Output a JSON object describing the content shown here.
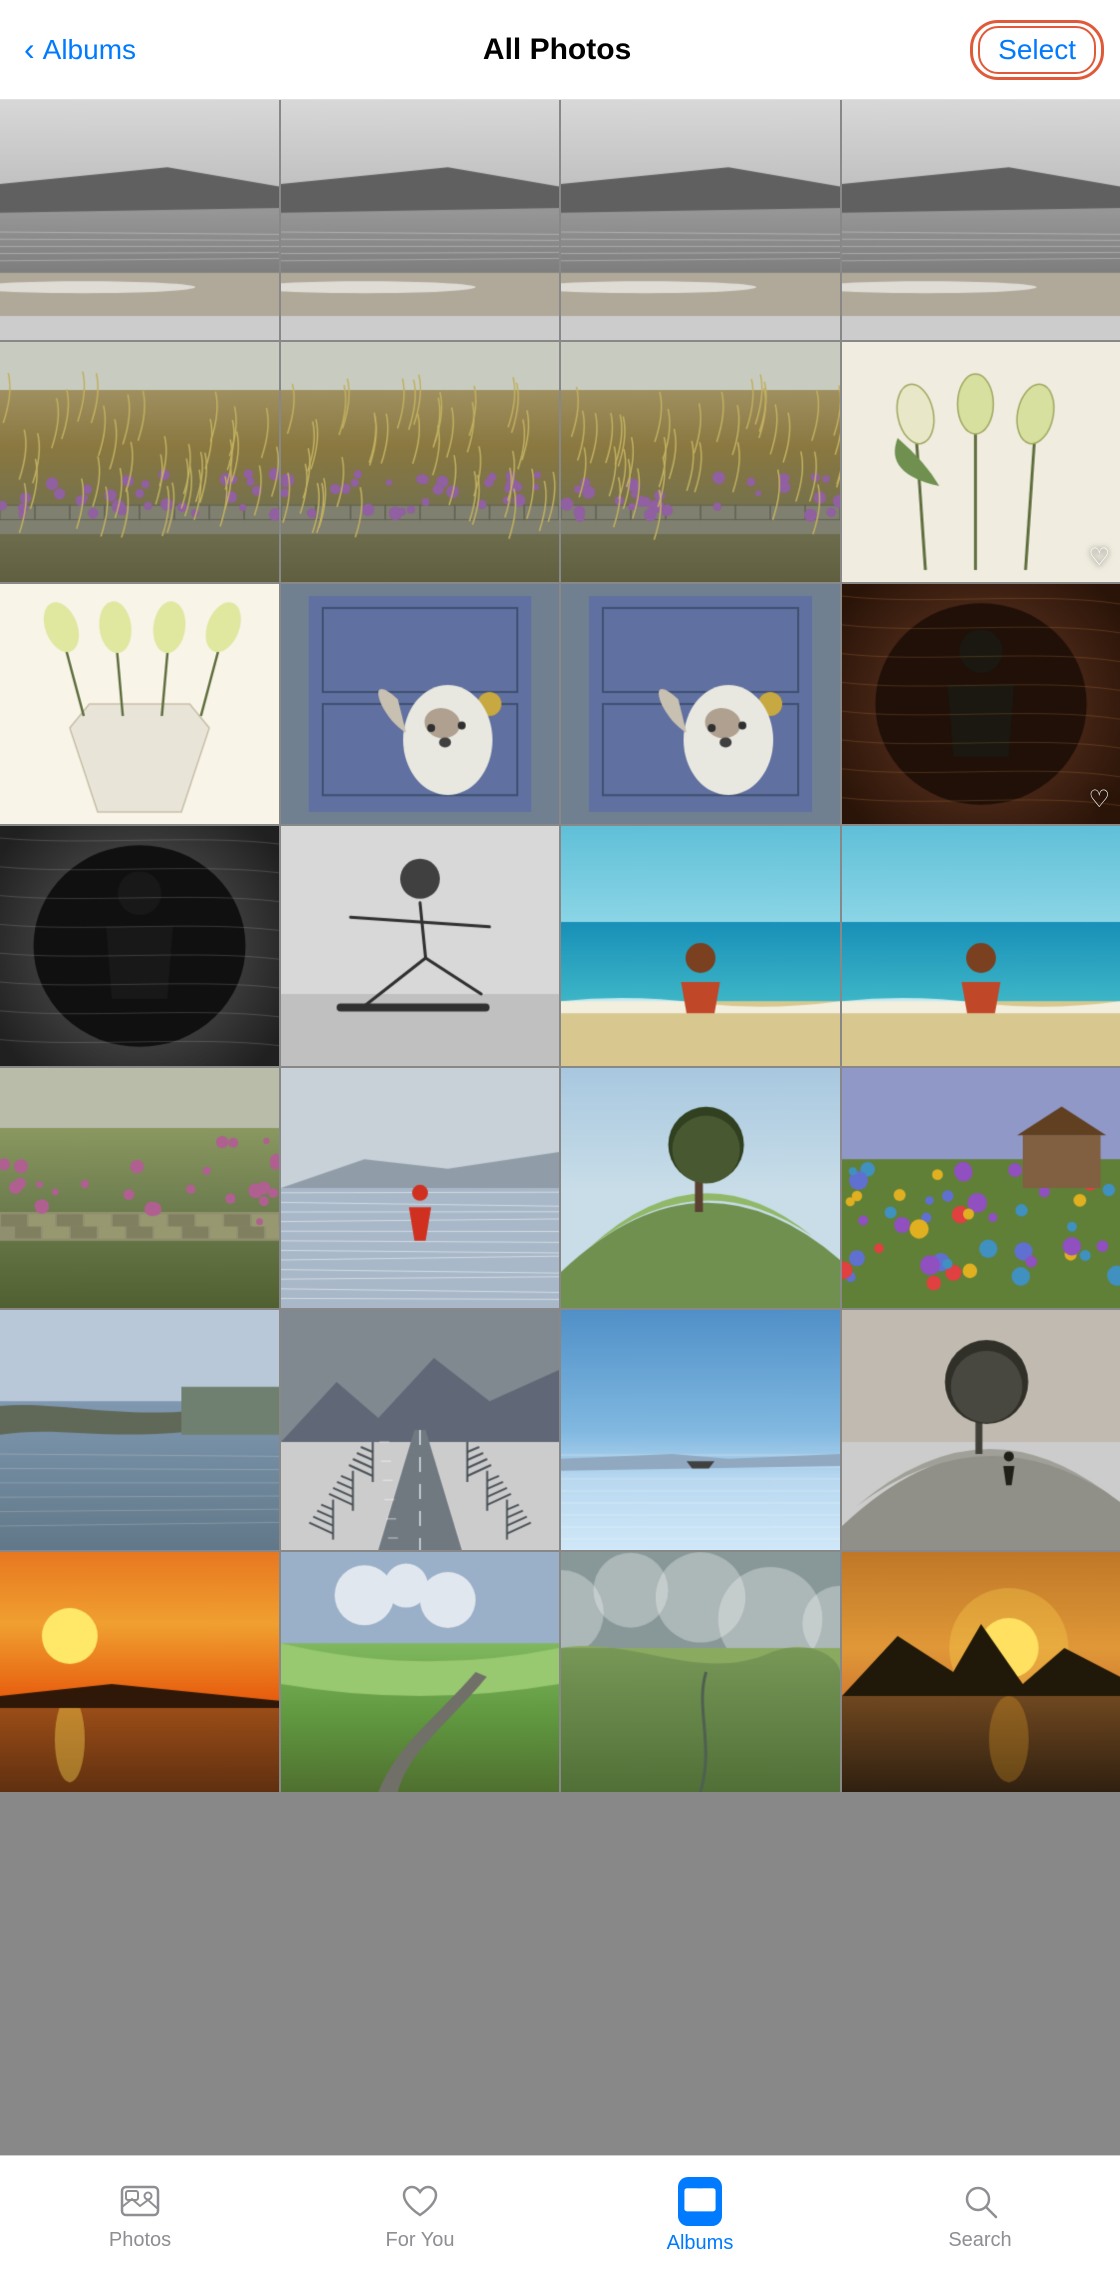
{
  "nav": {
    "back_label": "Albums",
    "title": "All Photos",
    "select_label": "Select"
  },
  "tabs": [
    {
      "id": "photos",
      "label": "Photos",
      "active": false
    },
    {
      "id": "for-you",
      "label": "For You",
      "active": false
    },
    {
      "id": "albums",
      "label": "Albums",
      "active": true
    },
    {
      "id": "search",
      "label": "Search",
      "active": false
    }
  ],
  "photos": [
    {
      "id": 1,
      "desc": "coastal landscape bw",
      "row": 0,
      "col": 0,
      "colors": [
        "#a0a0a0",
        "#888",
        "#606060",
        "#d0d0d0"
      ],
      "heart": false
    },
    {
      "id": 2,
      "desc": "coastal landscape bw 2",
      "row": 0,
      "col": 1,
      "colors": [
        "#a0a0a0",
        "#888",
        "#606060",
        "#d0d0d0"
      ],
      "heart": false
    },
    {
      "id": 3,
      "desc": "coastal landscape bw 3",
      "row": 0,
      "col": 2,
      "colors": [
        "#a0a0a0",
        "#888",
        "#606060",
        "#d0d0d0"
      ],
      "heart": false
    },
    {
      "id": 4,
      "desc": "coastal landscape bw 4",
      "row": 0,
      "col": 3,
      "colors": [
        "#a0a0a0",
        "#888",
        "#606060",
        "#d0d0d0"
      ],
      "heart": false
    },
    {
      "id": 5,
      "desc": "grass fields purple flowers",
      "row": 1,
      "col": 0,
      "colors": [
        "#7a8a60",
        "#5d6b45",
        "#c8b060",
        "#9a7a50"
      ],
      "heart": false
    },
    {
      "id": 6,
      "desc": "grass fields purple flowers 2",
      "row": 1,
      "col": 1,
      "colors": [
        "#7a8a60",
        "#5d6b45",
        "#c8b060",
        "#9a7a50"
      ],
      "heart": false
    },
    {
      "id": 7,
      "desc": "grass fields purple flowers 3",
      "row": 1,
      "col": 2,
      "colors": [
        "#7a8a60",
        "#5d6b45",
        "#c8b060",
        "#9a7a50"
      ],
      "heart": false
    },
    {
      "id": 8,
      "desc": "white tulips on white background",
      "row": 1,
      "col": 3,
      "colors": [
        "#f0ede0",
        "#d0cc90",
        "#b0c870",
        "#e8e8d0"
      ],
      "heart": true
    },
    {
      "id": 9,
      "desc": "white tulips vase",
      "row": 2,
      "col": 0,
      "colors": [
        "#f0ede0",
        "#d0cc90",
        "#b0c870",
        "#f8f8f0"
      ],
      "heart": false
    },
    {
      "id": 10,
      "desc": "dog in doorway",
      "row": 2,
      "col": 1,
      "colors": [
        "#7088a0",
        "#5a6878",
        "#8898a8",
        "#c8c8c8"
      ],
      "heart": false
    },
    {
      "id": 11,
      "desc": "dog in doorway 2",
      "row": 2,
      "col": 2,
      "colors": [
        "#7088a0",
        "#5a6878",
        "#8898a8",
        "#c8c8c8"
      ],
      "heart": false
    },
    {
      "id": 12,
      "desc": "child in tree hollow",
      "row": 2,
      "col": 3,
      "colors": [
        "#6a5040",
        "#4a3828",
        "#8a7060",
        "#302018"
      ],
      "heart": true
    },
    {
      "id": 13,
      "desc": "child bw tree hollow",
      "row": 3,
      "col": 0,
      "colors": [
        "#888888",
        "#606060",
        "#a0a0a0",
        "#404040"
      ],
      "heart": false
    },
    {
      "id": 14,
      "desc": "skateboarder bw",
      "row": 3,
      "col": 1,
      "colors": [
        "#c0c0c0",
        "#a0a0a0",
        "#808080",
        "#e0e0e0"
      ],
      "heart": false
    },
    {
      "id": 15,
      "desc": "girl on beach turquoise water",
      "row": 3,
      "col": 2,
      "colors": [
        "#40b0c0",
        "#70d0d8",
        "#d0b880",
        "#2090a8"
      ],
      "heart": false
    },
    {
      "id": 16,
      "desc": "girl on beach 2",
      "row": 3,
      "col": 3,
      "colors": [
        "#40b0c0",
        "#70d0d8",
        "#d0b880",
        "#2090a8"
      ],
      "heart": false
    },
    {
      "id": 17,
      "desc": "grass stone wall landscape",
      "row": 4,
      "col": 0,
      "colors": [
        "#6a8850",
        "#4a6030",
        "#9aa870",
        "#7a7060"
      ],
      "heart": false
    },
    {
      "id": 18,
      "desc": "person in icy water",
      "row": 4,
      "col": 1,
      "colors": [
        "#b8c8d8",
        "#a0b0c0",
        "#d0d8e0",
        "#8898a8"
      ],
      "heart": false
    },
    {
      "id": 19,
      "desc": "lone tree on green hill",
      "row": 4,
      "col": 2,
      "colors": [
        "#607848",
        "#78a058",
        "#a0c878",
        "#b8d8a0"
      ],
      "heart": false
    },
    {
      "id": 20,
      "desc": "wildflower meadow cottage",
      "row": 4,
      "col": 3,
      "colors": [
        "#6878a0",
        "#8898c0",
        "#607840",
        "#a0b870"
      ],
      "heart": false
    },
    {
      "id": 21,
      "desc": "peninsula water landscape",
      "row": 5,
      "col": 0,
      "colors": [
        "#a0b0c0",
        "#788898",
        "#c8d0d8",
        "#606878"
      ],
      "heart": false
    },
    {
      "id": 22,
      "desc": "road through mountains",
      "row": 5,
      "col": 1,
      "colors": [
        "#6a7880",
        "#889098",
        "#9090a0",
        "#485060"
      ],
      "heart": false
    },
    {
      "id": 23,
      "desc": "blue sky water horizon",
      "row": 5,
      "col": 2,
      "colors": [
        "#70a8d8",
        "#a8cce8",
        "#d0e8f8",
        "#5090c0"
      ],
      "heart": false
    },
    {
      "id": 24,
      "desc": "lone tree on hill grayscale",
      "row": 5,
      "col": 3,
      "colors": [
        "#909090",
        "#707070",
        "#b0b0b0",
        "#505050"
      ],
      "heart": false
    },
    {
      "id": 25,
      "desc": "sunset orange sky water",
      "row": 6,
      "col": 0,
      "colors": [
        "#e87820",
        "#f0a030",
        "#c06010",
        "#805020"
      ],
      "heart": false
    },
    {
      "id": 26,
      "desc": "green rolling hills road",
      "row": 6,
      "col": 1,
      "colors": [
        "#6a9850",
        "#88b868",
        "#b0d090",
        "#a0c070"
      ],
      "heart": false
    },
    {
      "id": 27,
      "desc": "green fields cloudy sky",
      "row": 6,
      "col": 2,
      "colors": [
        "#7898b0",
        "#a0b8c8",
        "#6a9860",
        "#88b070"
      ],
      "heart": false
    },
    {
      "id": 28,
      "desc": "sunset silhouette mountains water",
      "row": 6,
      "col": 3,
      "colors": [
        "#c88030",
        "#e0a040",
        "#304050",
        "#604820"
      ],
      "heart": false
    }
  ]
}
